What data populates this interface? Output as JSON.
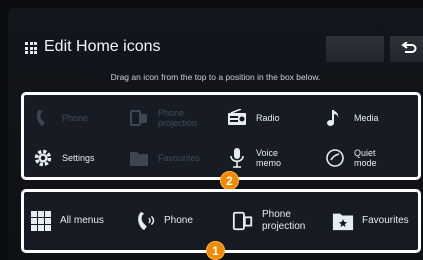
{
  "header": {
    "title": "Edit Home icons"
  },
  "instruction": "Drag an icon from the top to a position in the box below.",
  "available_icons": [
    {
      "label": "Phone",
      "icon": "phone-icon",
      "enabled": false
    },
    {
      "label": "Phone\nprojection",
      "icon": "phone-projection-icon",
      "enabled": false
    },
    {
      "label": "Radio",
      "icon": "radio-icon",
      "enabled": true
    },
    {
      "label": "Media",
      "icon": "music-note-icon",
      "enabled": true
    },
    {
      "label": "Settings",
      "icon": "gear-icon",
      "enabled": true
    },
    {
      "label": "Favourites",
      "icon": "favourites-icon",
      "enabled": false
    },
    {
      "label": "Voice\nmemo",
      "icon": "microphone-icon",
      "enabled": true
    },
    {
      "label": "Quiet\nmode",
      "icon": "quiet-mode-icon",
      "enabled": true
    }
  ],
  "home_icons": [
    {
      "label": "All menus",
      "icon": "all-menus-icon"
    },
    {
      "label": "Phone",
      "icon": "phone-icon"
    },
    {
      "label": "Phone\nprojection",
      "icon": "phone-projection-icon"
    },
    {
      "label": "Favourites",
      "icon": "favourites-icon"
    }
  ],
  "badges": {
    "top": "2",
    "bottom": "1"
  },
  "colors": {
    "badge": "#f08a00",
    "panel_border": "#ffffff"
  }
}
